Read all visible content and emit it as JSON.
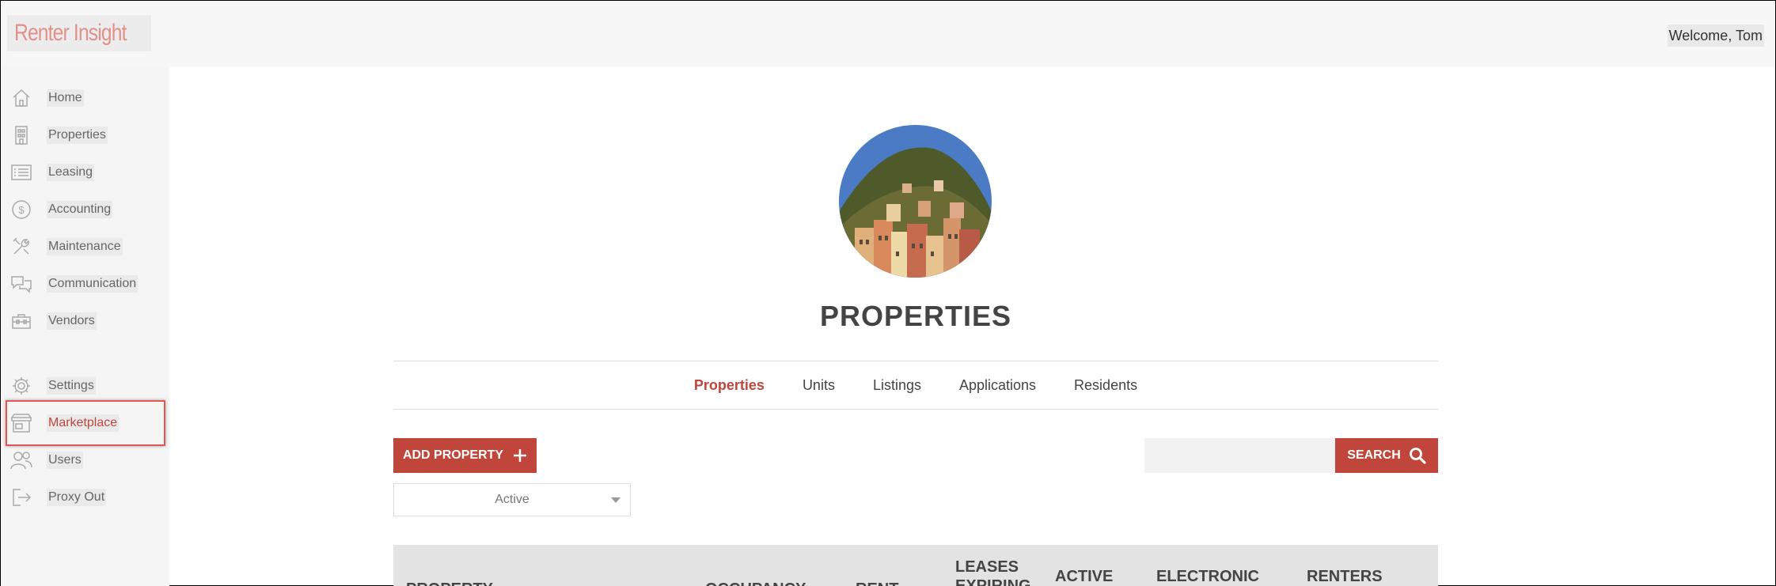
{
  "app": {
    "logo_text": "Renter Insight",
    "welcome": "Welcome, Tom",
    "brand_color": "#c0463b"
  },
  "sidebar": {
    "items": [
      {
        "label": "Home",
        "icon": "home-icon"
      },
      {
        "label": "Properties",
        "icon": "building-icon"
      },
      {
        "label": "Leasing",
        "icon": "list-icon"
      },
      {
        "label": "Accounting",
        "icon": "dollar-icon"
      },
      {
        "label": "Maintenance",
        "icon": "tools-icon"
      },
      {
        "label": "Communication",
        "icon": "chat-icon"
      },
      {
        "label": "Vendors",
        "icon": "briefcase-icon"
      },
      {
        "label": "Settings",
        "icon": "gear-icon"
      },
      {
        "label": "Marketplace",
        "icon": "store-icon",
        "active": true
      },
      {
        "label": "Users",
        "icon": "users-icon"
      },
      {
        "label": "Proxy Out",
        "icon": "logout-icon"
      }
    ]
  },
  "main": {
    "title": "PROPERTIES",
    "tabs": [
      {
        "label": "Properties",
        "active": true
      },
      {
        "label": "Units"
      },
      {
        "label": "Listings"
      },
      {
        "label": "Applications"
      },
      {
        "label": "Residents"
      }
    ],
    "add_button": "ADD PROPERTY",
    "search_button": "SEARCH",
    "search_placeholder": "",
    "status_filter": "Active",
    "table_headers": [
      "PROPERTY",
      "OCCUPANCY",
      "RENT",
      "LEASES EXPIRING",
      "ACTIVE",
      "ELECTRONIC",
      "RENTERS"
    ]
  }
}
